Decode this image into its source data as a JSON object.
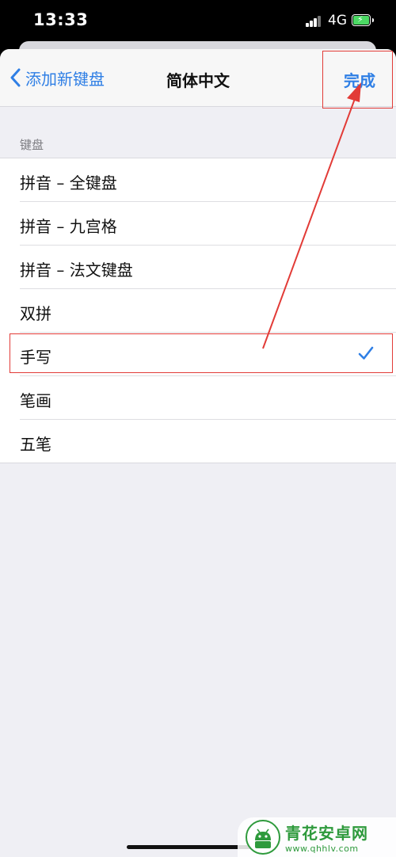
{
  "status_bar": {
    "time": "13:33",
    "network": "4G"
  },
  "nav": {
    "back_label": "添加新键盘",
    "title": "简体中文",
    "done_label": "完成"
  },
  "section": {
    "header": "键盘"
  },
  "keyboards": [
    {
      "label": "拼音 – 全键盘",
      "checked": false
    },
    {
      "label": "拼音 – 九宫格",
      "checked": false
    },
    {
      "label": "拼音 – 法文键盘",
      "checked": false
    },
    {
      "label": "双拼",
      "checked": false
    },
    {
      "label": "手写",
      "checked": true
    },
    {
      "label": "笔画",
      "checked": false
    },
    {
      "label": "五笔",
      "checked": false
    }
  ],
  "watermark": {
    "title": "青花安卓网",
    "url": "www.qhhlv.com"
  },
  "colors": {
    "accent": "#2f7fe5",
    "annotation": "#e23b37",
    "battery": "#4cd964"
  }
}
